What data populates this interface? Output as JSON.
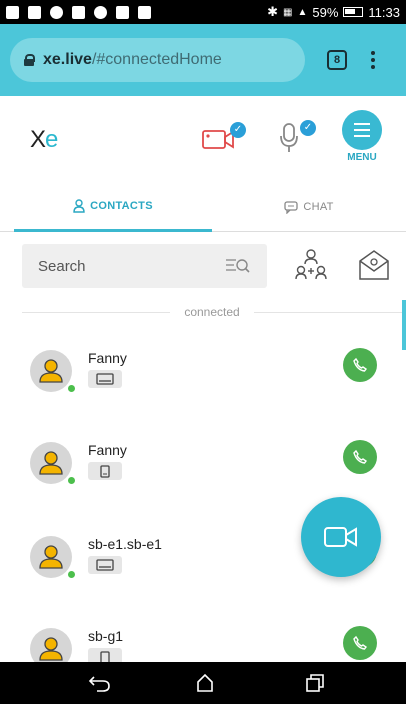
{
  "status_bar": {
    "battery": "59%",
    "time": "11:33"
  },
  "browser": {
    "url_host": "xe.live",
    "url_path": "/#connectedHome",
    "tab_count": "8"
  },
  "header": {
    "logo_x": "X",
    "logo_e": "e",
    "menu_label": "MENU"
  },
  "tabs": [
    {
      "label": "CONTACTS",
      "active": true
    },
    {
      "label": "CHAT",
      "active": false
    }
  ],
  "search": {
    "placeholder": "Search"
  },
  "divider_label": "connected",
  "contacts": [
    {
      "name": "Fanny",
      "device": "desktop-icon",
      "online": true
    },
    {
      "name": "Fanny",
      "device": "mobile-icon",
      "online": true
    },
    {
      "name": "sb-e1.sb-e1",
      "device": "desktop-icon",
      "online": true
    },
    {
      "name": "sb-g1",
      "device": "mobile-icon",
      "online": false
    }
  ],
  "colors": {
    "accent": "#39b9d2",
    "browser_bar": "#4cc6d9",
    "call_green": "#4caf50",
    "online_green": "#4cbf4c"
  }
}
